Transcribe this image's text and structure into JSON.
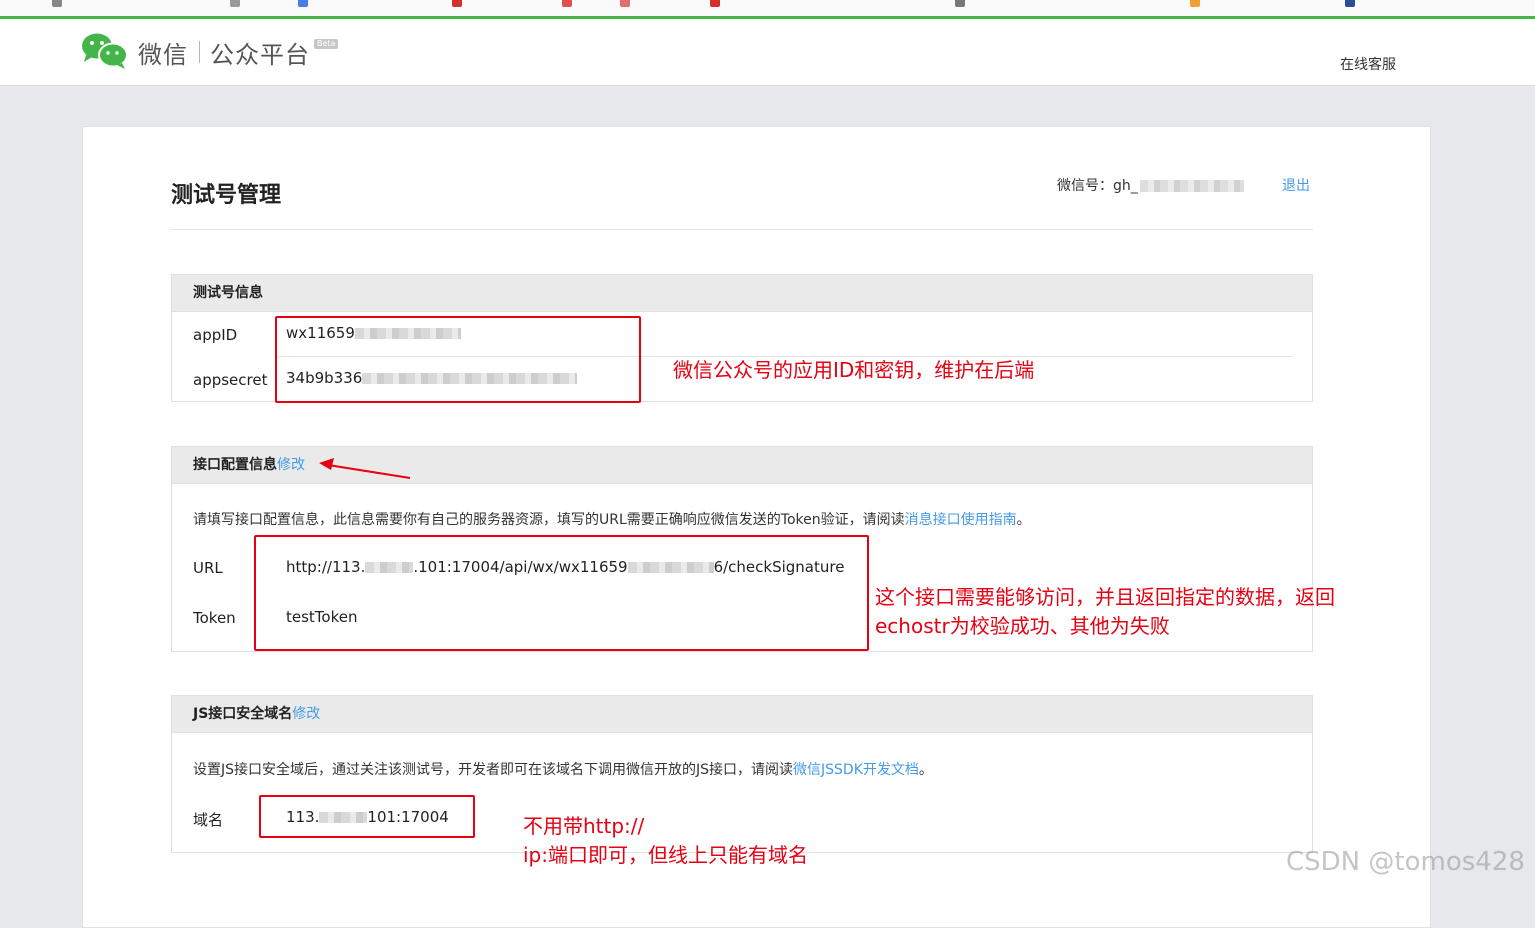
{
  "header": {
    "brand": "微信",
    "brand_sub": "公众平台",
    "beta": "Beta",
    "service_link": "在线客服"
  },
  "page": {
    "title": "测试号管理",
    "account_label": "微信号：",
    "account_value": "gh_",
    "logout": "退出"
  },
  "test_account": {
    "heading": "测试号信息",
    "appid_label": "appID",
    "appid_value": "wx11659",
    "appsecret_label": "appsecret",
    "appsecret_value": "34b9b336"
  },
  "interface_config": {
    "heading": "接口配置信息",
    "edit": "修改",
    "description": "请填写接口配置信息，此信息需要你有自己的服务器资源，填写的URL需要正确响应微信发送的Token验证，请阅读",
    "link": "消息接口使用指南",
    "end": "。",
    "url_label": "URL",
    "url_prefix": "http://113.",
    "url_middle": ".101:17004/api/wx/wx11659",
    "url_suffix": "6/checkSignature",
    "token_label": "Token",
    "token_value": "testToken"
  },
  "js_domain": {
    "heading": "JS接口安全域名",
    "edit": "修改",
    "description": "设置JS接口安全域后，通过关注该测试号，开发者即可在该域名下调用微信开放的JS接口，请阅读",
    "link": "微信JSSDK开发文档",
    "end": "。",
    "domain_label": "域名",
    "domain_prefix": "113.",
    "domain_suffix": "101:17004"
  },
  "annotations": {
    "note1": "微信公众号的应用ID和密钥，维护在后端",
    "note2_line1": "这个接口需要能够访问，并且返回指定的数据，返回",
    "note2_line2": "echostr为校验成功、其他为失败",
    "note3_line1": "不用带http://",
    "note3_line2": "ip:端口即可，但线上只能有域名",
    "color": "#e60012"
  },
  "watermark": "CSDN @tomos428",
  "colors": {
    "accent": "#44b549",
    "link": "#459ae9",
    "annotation": "#e60012"
  }
}
